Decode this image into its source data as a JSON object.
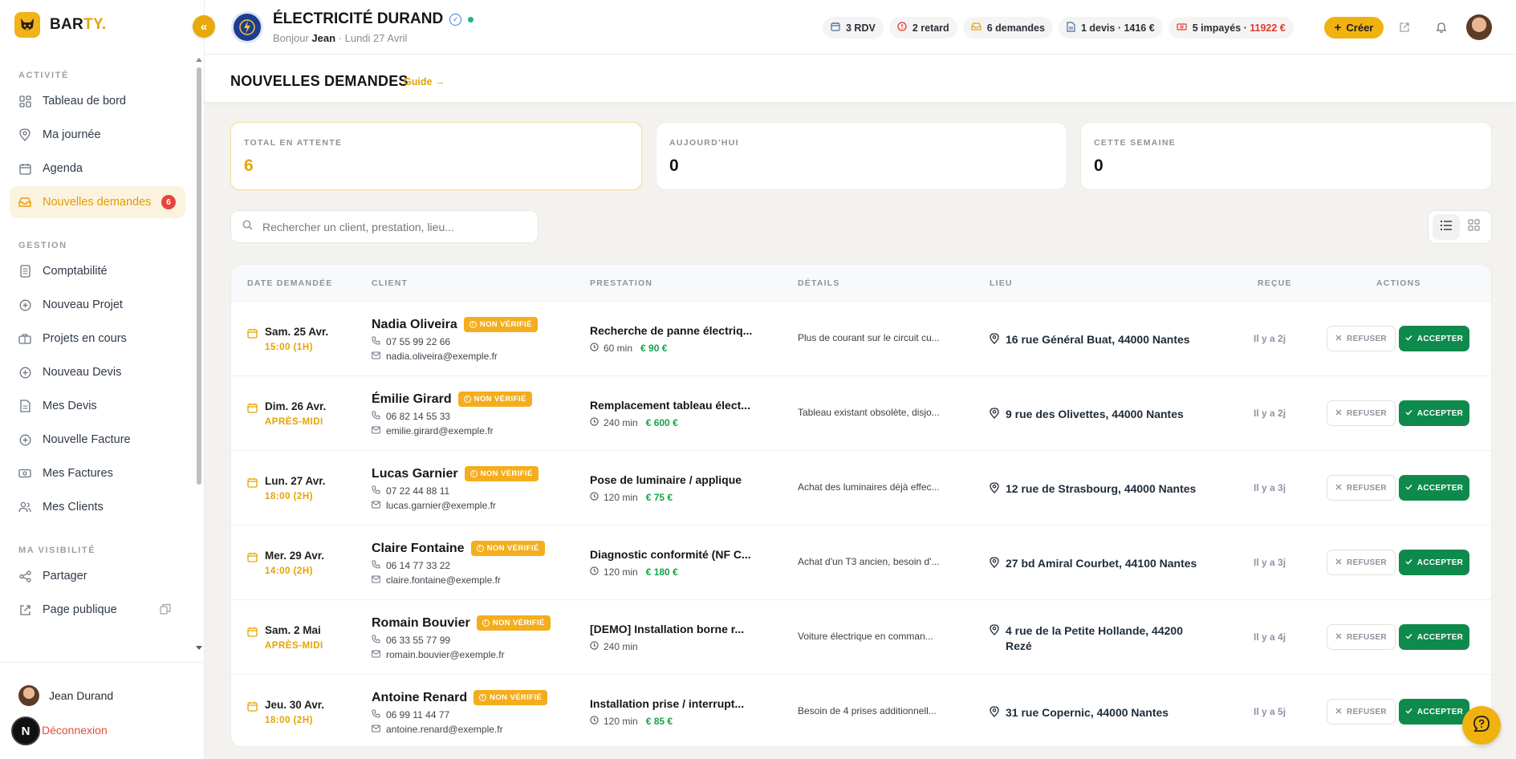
{
  "sidebar": {
    "brand": {
      "prefix": "BAR",
      "suffix": "TY."
    },
    "collapse_label": "«",
    "sections": [
      {
        "label": "ACTIVITÉ",
        "items": [
          {
            "label": "Tableau de bord",
            "icon": "dashboard-icon"
          },
          {
            "label": "Ma journée",
            "icon": "location-pin-icon"
          },
          {
            "label": "Agenda",
            "icon": "calendar-icon"
          },
          {
            "label": "Nouvelles demandes",
            "icon": "inbox-icon",
            "active": true,
            "badge": "6"
          }
        ]
      },
      {
        "label": "GESTION",
        "items": [
          {
            "label": "Comptabilité",
            "icon": "document-icon"
          },
          {
            "label": "Nouveau Projet",
            "icon": "plus-circle-icon"
          },
          {
            "label": "Projets en cours",
            "icon": "briefcase-icon"
          },
          {
            "label": "Nouveau Devis",
            "icon": "plus-circle-icon"
          },
          {
            "label": "Mes Devis",
            "icon": "file-icon"
          },
          {
            "label": "Nouvelle Facture",
            "icon": "plus-circle-icon"
          },
          {
            "label": "Mes Factures",
            "icon": "banknote-icon"
          },
          {
            "label": "Mes Clients",
            "icon": "users-icon"
          }
        ]
      },
      {
        "label": "MA VISIBILITÉ",
        "items": [
          {
            "label": "Partager",
            "icon": "share-icon"
          },
          {
            "label": "Page publique",
            "icon": "external-link-icon"
          }
        ]
      }
    ],
    "user_name": "Jean Durand",
    "logout_label": "Déconnexion",
    "dev_badge": "N"
  },
  "header": {
    "company_name": "ÉLECTRICITÉ DURAND",
    "greeting_prefix": "Bonjour ",
    "greeting_name": "Jean",
    "greeting_date": " · Lundi 27 Avril",
    "chips": {
      "rdv": "3 RDV",
      "retard": "2 retard",
      "demandes": "6 demandes",
      "devis": "1 devis · 1416 €",
      "impayes_prefix": "5 impayés · ",
      "impayes_amount": "11922 €"
    },
    "create_label": "Créer"
  },
  "page": {
    "title": "NOUVELLES DEMANDES",
    "guide_label": "Guide →"
  },
  "stats": [
    {
      "label": "TOTAL EN ATTENTE",
      "value": "6"
    },
    {
      "label": "AUJOURD'HUI",
      "value": "0"
    },
    {
      "label": "CETTE SEMAINE",
      "value": "0"
    }
  ],
  "search": {
    "placeholder": "Rechercher un client, prestation, lieu..."
  },
  "table": {
    "headers": {
      "date": "DATE DEMANDÉE",
      "client": "CLIENT",
      "prestation": "PRESTATION",
      "details": "DÉTAILS",
      "lieu": "LIEU",
      "recue": "REÇUE",
      "actions": "ACTIONS"
    },
    "badge_label": "NON VÉRIFIÉ",
    "refuse_label": "REFUSER",
    "accept_label": "ACCEPTER",
    "rows": [
      {
        "date": "Sam. 25 Avr.",
        "slot": "15:00 (1H)",
        "client": "Nadia Oliveira",
        "phone": "07 55 99 22 66",
        "email": "nadia.oliveira@exemple.fr",
        "prestation": "Recherche de panne électriq...",
        "duration": "60 min",
        "price": "€ 90 €",
        "details": "Plus de courant sur le circuit cu...",
        "lieu": "16 rue Général Buat, 44000 Nantes",
        "recue": "Il y a 2j"
      },
      {
        "date": "Dim. 26 Avr.",
        "slot": "APRÈS-MIDI",
        "client": "Émilie Girard",
        "phone": "06 82 14 55 33",
        "email": "emilie.girard@exemple.fr",
        "prestation": "Remplacement tableau élect...",
        "duration": "240 min",
        "price": "€ 600 €",
        "details": "Tableau existant obsolète, disjo...",
        "lieu": "9 rue des Olivettes, 44000 Nantes",
        "recue": "Il y a 2j"
      },
      {
        "date": "Lun. 27 Avr.",
        "slot": "18:00 (2H)",
        "client": "Lucas Garnier",
        "phone": "07 22 44 88 11",
        "email": "lucas.garnier@exemple.fr",
        "prestation": "Pose de luminaire / applique",
        "duration": "120 min",
        "price": "€ 75 €",
        "details": "Achat des luminaires déjà effec...",
        "lieu": "12 rue de Strasbourg, 44000 Nantes",
        "recue": "Il y a 3j"
      },
      {
        "date": "Mer. 29 Avr.",
        "slot": "14:00 (2H)",
        "client": "Claire Fontaine",
        "phone": "06 14 77 33 22",
        "email": "claire.fontaine@exemple.fr",
        "prestation": "Diagnostic conformité (NF C...",
        "duration": "120 min",
        "price": "€ 180 €",
        "details": "Achat d'un T3 ancien, besoin d'...",
        "lieu": "27 bd Amiral Courbet, 44100 Nantes",
        "recue": "Il y a 3j"
      },
      {
        "date": "Sam. 2 Mai",
        "slot": "APRÈS-MIDI",
        "client": "Romain Bouvier",
        "phone": "06 33 55 77 99",
        "email": "romain.bouvier@exemple.fr",
        "prestation": "[DEMO] Installation borne r...",
        "duration": "240 min",
        "price": "",
        "details": "Voiture électrique en comman...",
        "lieu": "4 rue de la Petite Hollande, 44200 Rezé",
        "recue": "Il y a 4j"
      },
      {
        "date": "Jeu. 30 Avr.",
        "slot": "18:00 (2H)",
        "client": "Antoine Renard",
        "phone": "06 99 11 44 77",
        "email": "antoine.renard@exemple.fr",
        "prestation": "Installation prise / interrupt...",
        "duration": "120 min",
        "price": "€ 85 €",
        "details": "Besoin de 4 prises additionnell...",
        "lieu": "31 rue Copernic, 44000 Nantes",
        "recue": "Il y a 5j"
      }
    ]
  },
  "colors": {
    "accent": "#f0b20f",
    "accept": "#0f8a4d",
    "danger": "#e23a2e",
    "price": "#16a34a"
  }
}
